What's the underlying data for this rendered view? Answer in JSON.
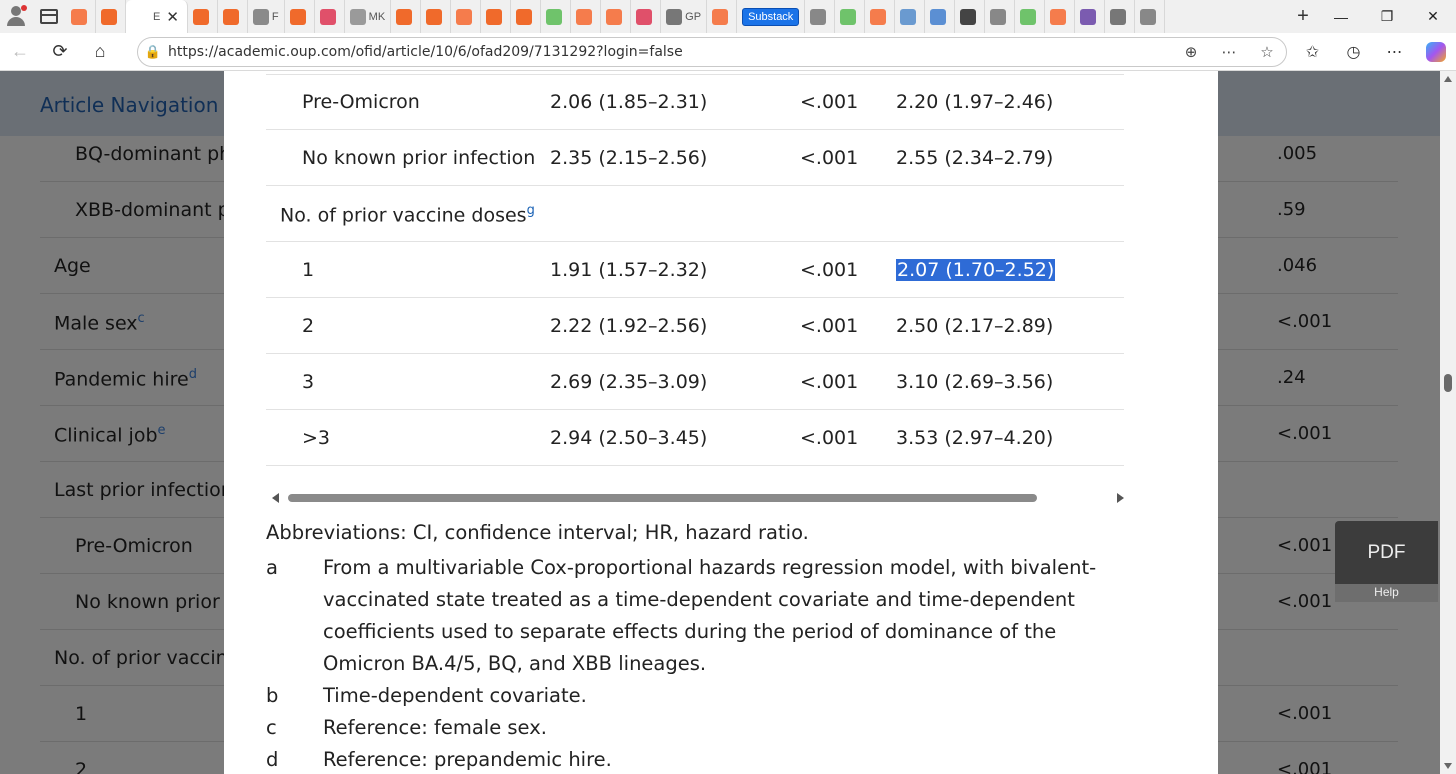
{
  "browser": {
    "url": "https://academic.oup.com/ofid/article/10/6/ofad209/7131292?login=false",
    "active_tab_mark": "E",
    "substack_tab": "Substack",
    "tabs": [
      {
        "color": "#f57c4c",
        "mark": ""
      },
      {
        "color": "#f06a2b",
        "mark": ""
      },
      {
        "color": "#ffffff",
        "mark": "E",
        "active": true
      },
      {
        "color": "#f06a2b",
        "mark": ""
      },
      {
        "color": "#f06a2b",
        "mark": ""
      },
      {
        "color": "#8a8a8a",
        "mark": "F"
      },
      {
        "color": "#f06a2b",
        "mark": ""
      },
      {
        "color": "#e0506a",
        "mark": ""
      },
      {
        "color": "#9a9a9a",
        "mark": "MK"
      },
      {
        "color": "#f06a2b",
        "mark": ""
      },
      {
        "color": "#f06a2b",
        "mark": ""
      },
      {
        "color": "#f57c4c",
        "mark": ""
      },
      {
        "color": "#f06a2b",
        "mark": ""
      },
      {
        "color": "#f06a2b",
        "mark": ""
      },
      {
        "color": "#6fc36b",
        "mark": ""
      },
      {
        "color": "#f57c4c",
        "mark": ""
      },
      {
        "color": "#f57c4c",
        "mark": ""
      },
      {
        "color": "#e0506a",
        "mark": ""
      },
      {
        "color": "#777777",
        "mark": "GP"
      },
      {
        "color": "#f57c4c",
        "mark": ""
      }
    ],
    "tabs_after": [
      {
        "color": "#888888",
        "mark": ""
      },
      {
        "color": "#6fc36b",
        "mark": ""
      },
      {
        "color": "#f57c4c",
        "mark": ""
      },
      {
        "color": "#6a9ad0",
        "mark": ""
      },
      {
        "color": "#5b8fd3",
        "mark": ""
      },
      {
        "color": "#444444",
        "mark": ""
      },
      {
        "color": "#888888",
        "mark": ""
      },
      {
        "color": "#6fc36b",
        "mark": ""
      },
      {
        "color": "#f57c4c",
        "mark": ""
      },
      {
        "color": "#7b5bb0",
        "mark": ""
      },
      {
        "color": "#777777",
        "mark": ""
      },
      {
        "color": "#888888",
        "mark": ""
      }
    ]
  },
  "background_page": {
    "nav_title": "Article Navigation",
    "rows": [
      {
        "label": "BQ-dominant ph",
        "indent": true,
        "p": ".005"
      },
      {
        "label": "XBB-dominant p",
        "indent": true,
        "p": ".59"
      },
      {
        "label": "Age",
        "indent": false,
        "p": ".046"
      },
      {
        "label": "Male sex",
        "sup": "c",
        "indent": false,
        "p": "<.001"
      },
      {
        "label": "Pandemic hire",
        "sup": "d",
        "indent": false,
        "p": ".24"
      },
      {
        "label": "Clinical job",
        "sup": "e",
        "indent": false,
        "p": "<.001"
      },
      {
        "label": "Last prior infection",
        "indent": false,
        "p": ""
      },
      {
        "label": "Pre-Omicron",
        "indent": true,
        "p": "<.001"
      },
      {
        "label": "No known prior i",
        "indent": true,
        "p": "<.001"
      },
      {
        "label": "No. of prior vaccine",
        "indent": false,
        "p": ""
      },
      {
        "label": "1",
        "indent": true,
        "p": "<.001"
      },
      {
        "label": "2",
        "indent": true,
        "p": "<.001"
      }
    ]
  },
  "table": {
    "rows": [
      {
        "label": "Pre-Omicron",
        "indent": true,
        "hr1": "2.06 (1.85–2.31)",
        "p": "<.001",
        "hr2": "2.20 (1.97–2.46)"
      },
      {
        "label": "No known prior infection",
        "indent": true,
        "hr1": "2.35 (2.15–2.56)",
        "p": "<.001",
        "hr2": "2.55 (2.34–2.79)"
      },
      {
        "label": "No. of prior vaccine doses",
        "sup": "g",
        "indent": false,
        "hr1": "",
        "p": "",
        "hr2": ""
      },
      {
        "label": "1",
        "indent": true,
        "hr1": "1.91 (1.57–2.32)",
        "p": "<.001",
        "hr2": "2.07 (1.70–2.52)",
        "selected": true
      },
      {
        "label": "2",
        "indent": true,
        "hr1": "2.22 (1.92–2.56)",
        "p": "<.001",
        "hr2": "2.50 (2.17–2.89)"
      },
      {
        "label": "3",
        "indent": true,
        "hr1": "2.69 (2.35–3.09)",
        "p": "<.001",
        "hr2": "3.10 (2.69–3.56)"
      },
      {
        "label": ">3",
        "indent": true,
        "hr1": "2.94 (2.50–3.45)",
        "p": "<.001",
        "hr2": "3.53 (2.97–4.20)"
      }
    ]
  },
  "abbreviations": "Abbreviations: CI, confidence interval; HR, hazard ratio.",
  "footnotes": [
    {
      "key": "a",
      "text": "From a multivariable Cox-proportional hazards regression model, with bivalent-vaccinated state treated as a time-dependent covariate and time-dependent coefficients used to separate effects during the period of dominance of the Omicron BA.4/5, BQ, and XBB lineages."
    },
    {
      "key": "b",
      "text": "Time-dependent covariate."
    },
    {
      "key": "c",
      "text": "Reference: female sex."
    },
    {
      "key": "d",
      "text": "Reference: prepandemic hire."
    }
  ],
  "pdf_button": "PDF",
  "help_button": "Help"
}
